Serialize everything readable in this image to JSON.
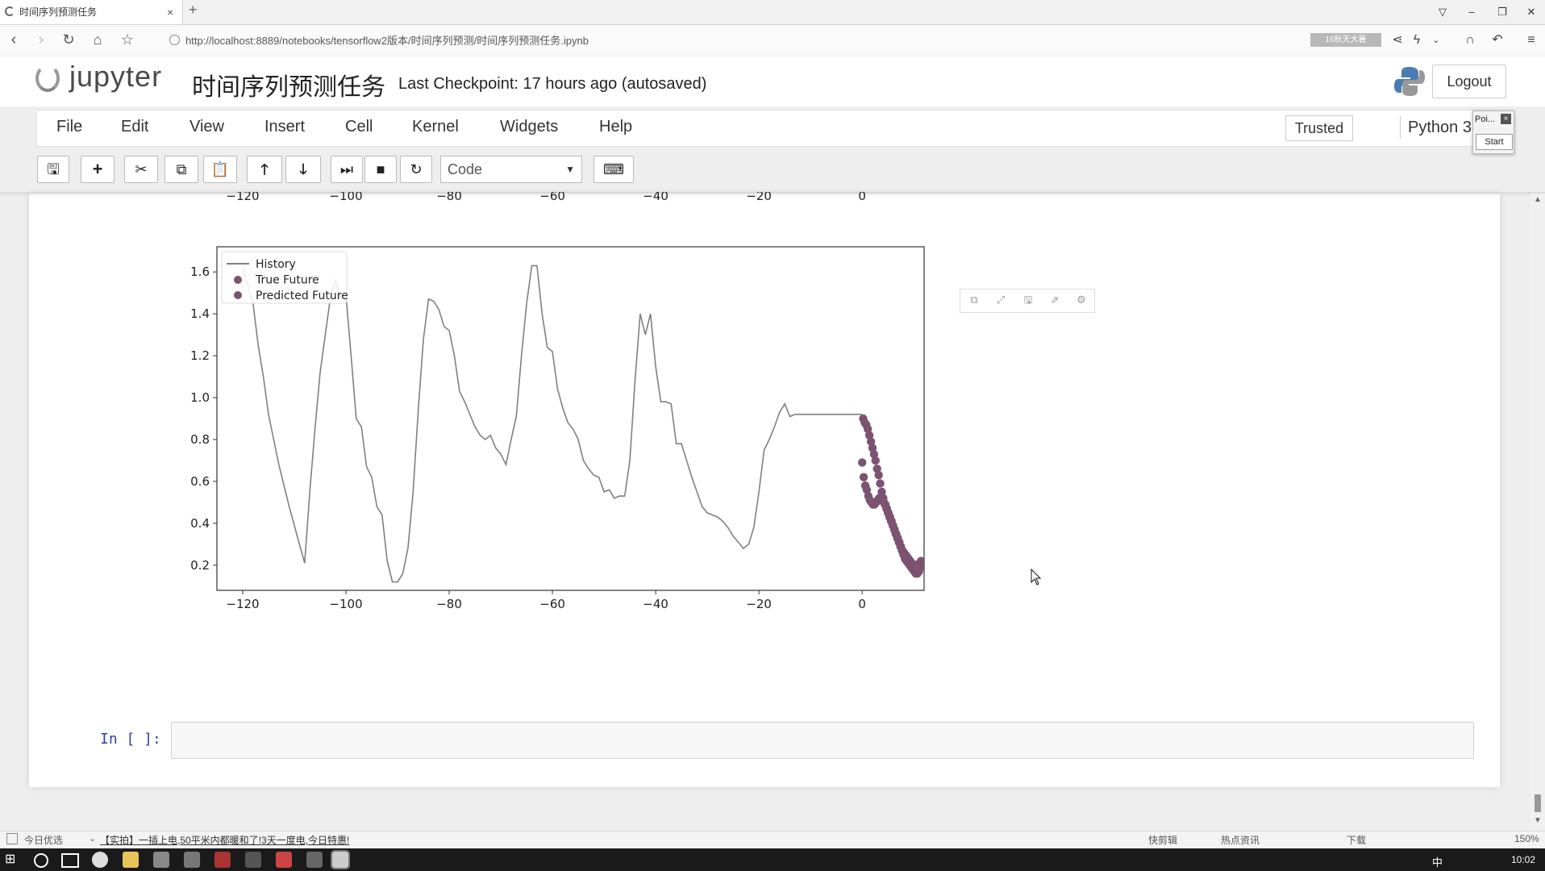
{
  "browser": {
    "tab_title": "时间序列预测任务",
    "tab_close": "×",
    "new_tab": "+",
    "url": "http://localhost:8889/notebooks/tensorflow2版本/时间序列预测/时间序列预测任务.ipynb",
    "url_badge": "16秋天大暑",
    "zoom": "150%"
  },
  "jupyter": {
    "logo_text": "jupyter",
    "notebook_title": "时间序列预测任务",
    "checkpoint": "Last Checkpoint: 17 hours ago (autosaved)",
    "logout_label": "Logout",
    "menus": [
      "File",
      "Edit",
      "View",
      "Insert",
      "Cell",
      "Kernel",
      "Widgets",
      "Help"
    ],
    "trusted_label": "Trusted",
    "kernel_name": "Python 3",
    "popup_title": "Poi...",
    "popup_close": "×",
    "popup_start": "Start",
    "cell_type": "Code",
    "input_prompt": "In [ ]:"
  },
  "status_bar": {
    "left_label": "今日优选",
    "news": "【实拍】一插上电,50平米内都暖和了!3天一度电,今日特惠!",
    "right_items": [
      "快剪辑",
      "热点资讯",
      "下载"
    ]
  },
  "taskbar": {
    "clock": "10:02",
    "ime": "中"
  },
  "chart_data": {
    "type": "line",
    "xlim": [
      -125,
      12
    ],
    "ylim": [
      0.08,
      1.72
    ],
    "x_ticks": [
      -120,
      -100,
      -80,
      -60,
      -40,
      -20,
      0
    ],
    "x_tick_labels": [
      "−120",
      "−100",
      "−80",
      "−60",
      "−40",
      "−20",
      "0"
    ],
    "y_ticks": [
      0.2,
      0.4,
      0.6,
      0.8,
      1.0,
      1.2,
      1.4,
      1.6
    ],
    "y_tick_labels": [
      "0.2",
      "0.4",
      "0.6",
      "0.8",
      "1.0",
      "1.2",
      "1.4",
      "1.6"
    ],
    "legend_position": "upper-left",
    "legend": [
      "History",
      "True Future",
      "Predicted Future"
    ],
    "colors": {
      "history": "#808080",
      "true_future": "#7b5370",
      "predicted_future": "#7b5370"
    },
    "history": {
      "x": [
        -120,
        -118,
        -117,
        -116,
        -115,
        -114,
        -113,
        -112,
        -111,
        -110,
        -109,
        -108,
        -107,
        -106,
        -105,
        -104,
        -103,
        -102,
        -101,
        -100,
        -99,
        -98,
        -97,
        -96,
        -95,
        -94,
        -93,
        -92,
        -91,
        -90,
        -89,
        -88,
        -87,
        -86,
        -85,
        -84,
        -83,
        -82,
        -81,
        -80,
        -79,
        -78,
        -77,
        -76,
        -75,
        -74,
        -73,
        -72,
        -71,
        -70,
        -69,
        -68,
        -67,
        -66,
        -65,
        -64,
        -63,
        -62,
        -61,
        -60,
        -59,
        -58,
        -57,
        -56,
        -55,
        -54,
        -53,
        -52,
        -51,
        -50,
        -49,
        -48,
        -47,
        -46,
        -45,
        -44,
        -43,
        -42,
        -41,
        -40,
        -39,
        -38,
        -37,
        -36,
        -35,
        -34,
        -33,
        -32,
        -31,
        -30,
        -29,
        -28,
        -27,
        -26,
        -25,
        -24,
        -23,
        -22,
        -21,
        -20,
        -19,
        -18,
        -17,
        -16,
        -15,
        -14,
        -13,
        -12,
        -11,
        -10,
        -9,
        -8,
        -7,
        -6,
        -5,
        -4,
        -3,
        -2,
        -1,
        0
      ],
      "y": [
        1.62,
        1.45,
        1.25,
        1.1,
        0.92,
        0.8,
        0.68,
        0.58,
        0.48,
        0.39,
        0.3,
        0.21,
        0.55,
        0.85,
        1.12,
        1.3,
        1.48,
        1.56,
        1.47,
        1.49,
        1.2,
        0.9,
        0.86,
        0.67,
        0.62,
        0.48,
        0.44,
        0.22,
        0.12,
        0.12,
        0.16,
        0.28,
        0.55,
        0.94,
        1.28,
        1.47,
        1.46,
        1.42,
        1.34,
        1.32,
        1.2,
        1.03,
        0.98,
        0.92,
        0.86,
        0.82,
        0.8,
        0.82,
        0.76,
        0.73,
        0.68,
        0.8,
        0.91,
        1.2,
        1.45,
        1.63,
        1.63,
        1.4,
        1.24,
        1.22,
        1.04,
        0.95,
        0.88,
        0.85,
        0.8,
        0.7,
        0.66,
        0.63,
        0.62,
        0.55,
        0.56,
        0.52,
        0.53,
        0.53,
        0.7,
        1.08,
        1.4,
        1.3,
        1.4,
        1.15,
        0.98,
        0.98,
        0.97,
        0.78,
        0.78,
        0.7,
        0.62,
        0.55,
        0.48,
        0.45,
        0.44,
        0.43,
        0.41,
        0.38,
        0.34,
        0.31,
        0.28,
        0.3,
        0.38,
        0.55,
        0.75,
        0.8,
        0.86,
        0.93,
        0.97,
        0.91,
        0.92,
        0.92,
        0.92,
        0.92,
        0.92,
        0.92,
        0.92,
        0.92,
        0.92,
        0.92,
        0.92,
        0.92,
        0.92,
        0.92
      ]
    },
    "true_future": {
      "x": [
        0.2,
        0.5,
        0.8,
        1.1,
        1.4,
        1.7,
        2.0,
        2.3,
        2.6,
        2.9,
        3.2,
        3.5,
        3.8,
        4.1,
        4.4,
        4.7,
        5.0,
        5.3,
        5.6,
        5.9,
        6.2,
        6.5,
        6.8,
        7.1,
        7.4,
        7.7,
        8.0,
        8.3,
        8.6,
        8.9,
        9.2,
        9.5,
        9.8,
        10.1,
        10.4,
        10.7,
        11.0,
        11.3
      ],
      "y": [
        0.9,
        0.88,
        0.87,
        0.85,
        0.82,
        0.79,
        0.76,
        0.73,
        0.7,
        0.66,
        0.63,
        0.59,
        0.55,
        0.52,
        0.49,
        0.47,
        0.45,
        0.43,
        0.41,
        0.39,
        0.37,
        0.35,
        0.33,
        0.31,
        0.29,
        0.27,
        0.25,
        0.23,
        0.22,
        0.21,
        0.2,
        0.19,
        0.18,
        0.17,
        0.16,
        0.16,
        0.17,
        0.19
      ]
    },
    "predicted_future": {
      "x": [
        0.0,
        0.3,
        0.6,
        0.9,
        1.2,
        1.5,
        1.8,
        2.1,
        2.4,
        2.7,
        3.0,
        3.3,
        3.6,
        3.9,
        4.2,
        4.5,
        4.8,
        5.1,
        5.4,
        5.7,
        6.0,
        6.3,
        6.6,
        6.9,
        7.2,
        7.5,
        7.8,
        8.1,
        8.4,
        8.7,
        9.0,
        9.3,
        9.6,
        9.9,
        10.2,
        10.5,
        10.8,
        11.1,
        11.4
      ],
      "y": [
        0.69,
        0.62,
        0.58,
        0.56,
        0.53,
        0.51,
        0.5,
        0.49,
        0.49,
        0.5,
        0.51,
        0.52,
        0.52,
        0.51,
        0.5,
        0.49,
        0.47,
        0.45,
        0.43,
        0.41,
        0.39,
        0.37,
        0.35,
        0.33,
        0.31,
        0.29,
        0.27,
        0.26,
        0.25,
        0.24,
        0.23,
        0.22,
        0.21,
        0.2,
        0.2,
        0.19,
        0.2,
        0.21,
        0.22
      ]
    }
  }
}
